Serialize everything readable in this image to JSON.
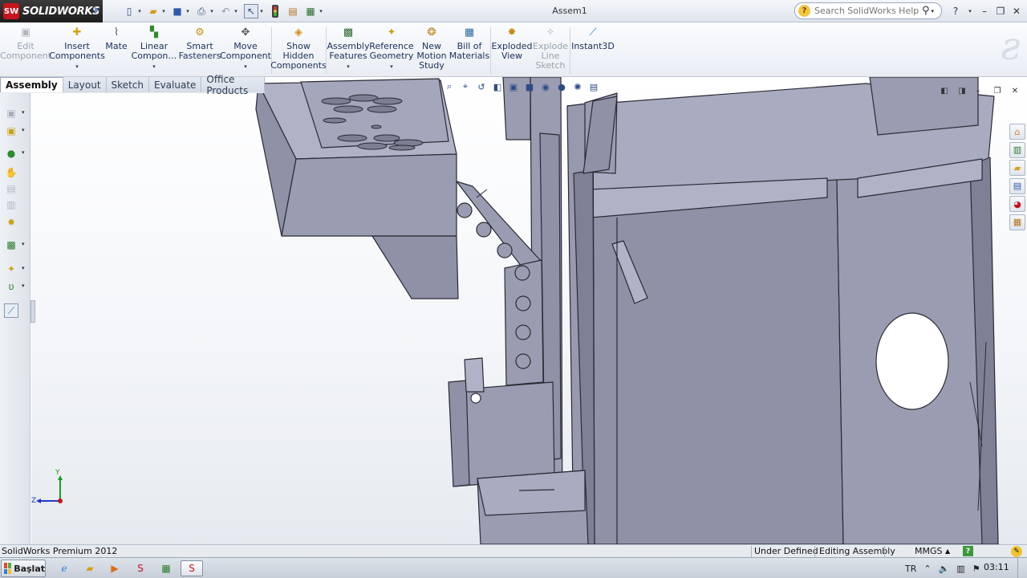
{
  "app": {
    "logo_badge": "SW",
    "logo_text": "SOLIDWORKS",
    "window_title": "Assem1"
  },
  "quick_access": [
    {
      "name": "new-icon",
      "glyph": "▯"
    },
    {
      "name": "open-icon",
      "glyph": "📂"
    },
    {
      "name": "save-icon",
      "glyph": "💾"
    },
    {
      "name": "print-icon",
      "glyph": "🖶"
    },
    {
      "name": "undo-icon",
      "glyph": "↶"
    },
    {
      "name": "select-icon",
      "glyph": "↖"
    },
    {
      "name": "rebuild-icon",
      "glyph": "●"
    },
    {
      "name": "file-properties-icon",
      "glyph": "▤"
    },
    {
      "name": "options-icon",
      "glyph": "▦"
    }
  ],
  "search": {
    "placeholder": "Search SolidWorks Help"
  },
  "command_manager": {
    "edit_component": "Edit\nComponent",
    "insert_components": "Insert\nComponents",
    "mate": "Mate",
    "linear_component": "Linear\nCompon…",
    "smart_fasteners": "Smart\nFasteners",
    "move_component": "Move\nComponent",
    "show_hidden": "Show\nHidden\nComponents",
    "assembly_features": "Assembly\nFeatures",
    "reference_geometry": "Reference\nGeometry",
    "new_motion_study": "New\nMotion\nStudy",
    "bill_of_materials": "Bill of\nMaterials",
    "exploded_view": "Exploded\nView",
    "explode_line_sketch": "Explode\nLine\nSketch",
    "instant3d": "Instant3D"
  },
  "tabs": [
    "Assembly",
    "Layout",
    "Sketch",
    "Evaluate",
    "Office Products"
  ],
  "triad": {
    "y": "Y",
    "z": "Z"
  },
  "status": {
    "product": "SolidWorks Premium 2012",
    "definition": "Under Defined",
    "mode": "Editing Assembly",
    "units": "MMGS",
    "help_glyph": "?"
  },
  "taskbar": {
    "start_label": "Başlat",
    "language": "TR",
    "clock": "03:11"
  },
  "colors": {
    "part_fill": "#9a9cb1",
    "part_top": "#b0b2c6",
    "part_dark": "#7e8096",
    "edge": "#2a2a35",
    "accent_red": "#c8141c"
  }
}
